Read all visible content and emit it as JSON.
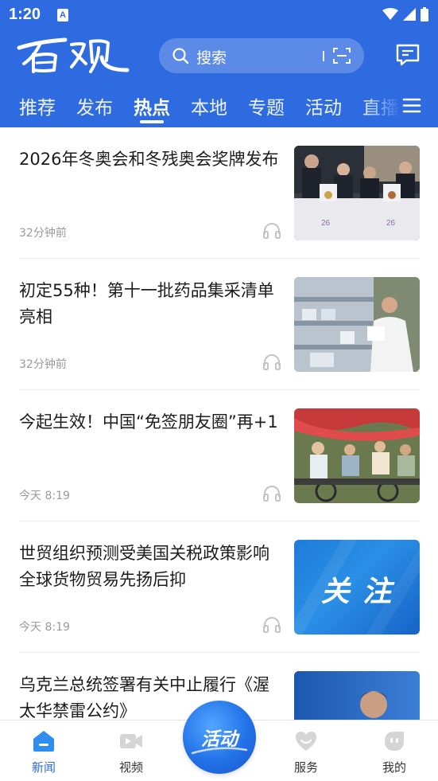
{
  "status_bar": {
    "time": "1:20",
    "notification_letter": "A"
  },
  "header": {
    "logo_text": "百观",
    "search_placeholder": "搜索",
    "channels": [
      {
        "label": "推荐",
        "active": false
      },
      {
        "label": "发布",
        "active": false
      },
      {
        "label": "热点",
        "active": true
      },
      {
        "label": "本地",
        "active": false
      },
      {
        "label": "专题",
        "active": false
      },
      {
        "label": "活动",
        "active": false
      },
      {
        "label": "直播",
        "active": false
      }
    ]
  },
  "feed": [
    {
      "title": "2026年冬奥会和冬残奥会奖牌发布",
      "time": "32分钟前",
      "image": "medal-ceremony-photo"
    },
    {
      "title": "初定55种！第十一批药品集采清单亮相",
      "time": "32分钟前",
      "image": "pharmacy-photo"
    },
    {
      "title": "今起生效！中国“免签朋友圈”再+1",
      "time": "今天 8:19",
      "image": "rickshaw-tourists-photo"
    },
    {
      "title": "世贸组织预测受美国关税政策影响全球货物贸易先扬后抑",
      "time": "今天 8:19",
      "image": "attention-banner",
      "image_text": "关 注"
    },
    {
      "title": "乌克兰总统签署有关中止履行《渥太华禁雷公约》",
      "time": "",
      "image": "portrait-photo"
    }
  ],
  "bottom_nav": {
    "tabs": [
      {
        "label": "新闻",
        "icon": "news-icon",
        "active": true
      },
      {
        "label": "视频",
        "icon": "video-icon",
        "active": false
      },
      {
        "label": "服务",
        "icon": "heart-service-icon",
        "active": false
      },
      {
        "label": "我的",
        "icon": "profile-icon",
        "active": false
      }
    ],
    "center_button_label": "活动"
  },
  "colors": {
    "brand_blue": "#2f6be0",
    "active_tab": "#2f6be0",
    "meta_gray": "#9a9a9a"
  }
}
